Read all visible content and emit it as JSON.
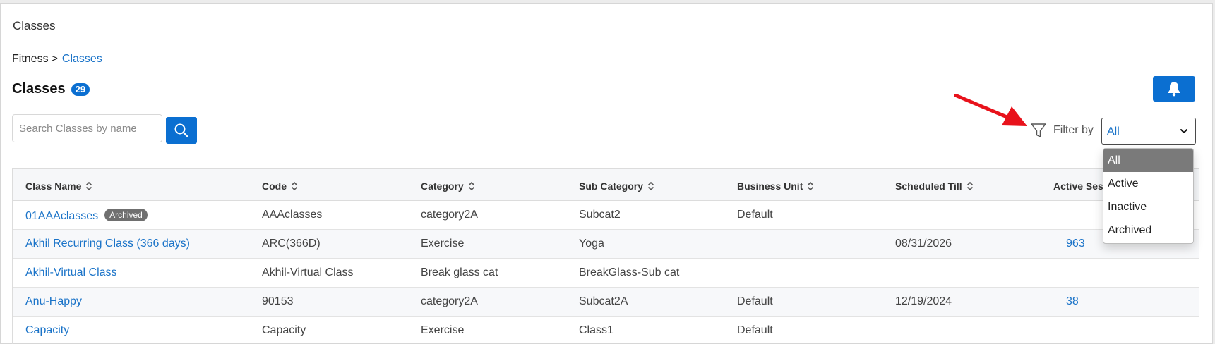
{
  "topbar": {
    "title": "Classes"
  },
  "breadcrumb": {
    "root": "Fitness",
    "separator": ">",
    "current": "Classes"
  },
  "page": {
    "title": "Classes",
    "count": "29"
  },
  "search": {
    "placeholder": "Search Classes by name",
    "value": ""
  },
  "filter": {
    "label": "Filter by",
    "selected": "All",
    "options": [
      "All",
      "Active",
      "Inactive",
      "Archived"
    ]
  },
  "table": {
    "headers": {
      "class_name": "Class Name",
      "code": "Code",
      "category": "Category",
      "sub_category": "Sub Category",
      "business_unit": "Business Unit",
      "scheduled_till": "Scheduled Till",
      "active_sessions": "Active Sessi"
    },
    "rows": [
      {
        "class_name": "01AAAclasses",
        "badge": "Archived",
        "code": "AAAclasses",
        "category": "category2A",
        "sub_category": "Subcat2",
        "business_unit": "Default",
        "scheduled_till": "",
        "active_sessions": ""
      },
      {
        "class_name": "Akhil Recurring Class (366 days)",
        "badge": "",
        "code": "ARC(366D)",
        "category": "Exercise",
        "sub_category": "Yoga",
        "business_unit": "",
        "scheduled_till": "08/31/2026",
        "active_sessions": "963"
      },
      {
        "class_name": "Akhil-Virtual Class",
        "badge": "",
        "code": "Akhil-Virtual Class",
        "category": "Break glass cat",
        "sub_category": "BreakGlass-Sub cat",
        "business_unit": "",
        "scheduled_till": "",
        "active_sessions": ""
      },
      {
        "class_name": "Anu-Happy",
        "badge": "",
        "code": "90153",
        "category": "category2A",
        "sub_category": "Subcat2A",
        "business_unit": "Default",
        "scheduled_till": "12/19/2024",
        "active_sessions": "38"
      },
      {
        "class_name": "Capacity",
        "badge": "",
        "code": "Capacity",
        "category": "Exercise",
        "sub_category": "Class1",
        "business_unit": "Default",
        "scheduled_till": "",
        "active_sessions": ""
      }
    ]
  },
  "icons": {
    "bell": "bell-icon",
    "search": "search-icon",
    "filter": "filter-funnel-icon",
    "annotation": "red-arrow-icon"
  },
  "colors": {
    "primary": "#0b6fd1",
    "link": "#1a73c8",
    "arrow": "#e8121b"
  }
}
